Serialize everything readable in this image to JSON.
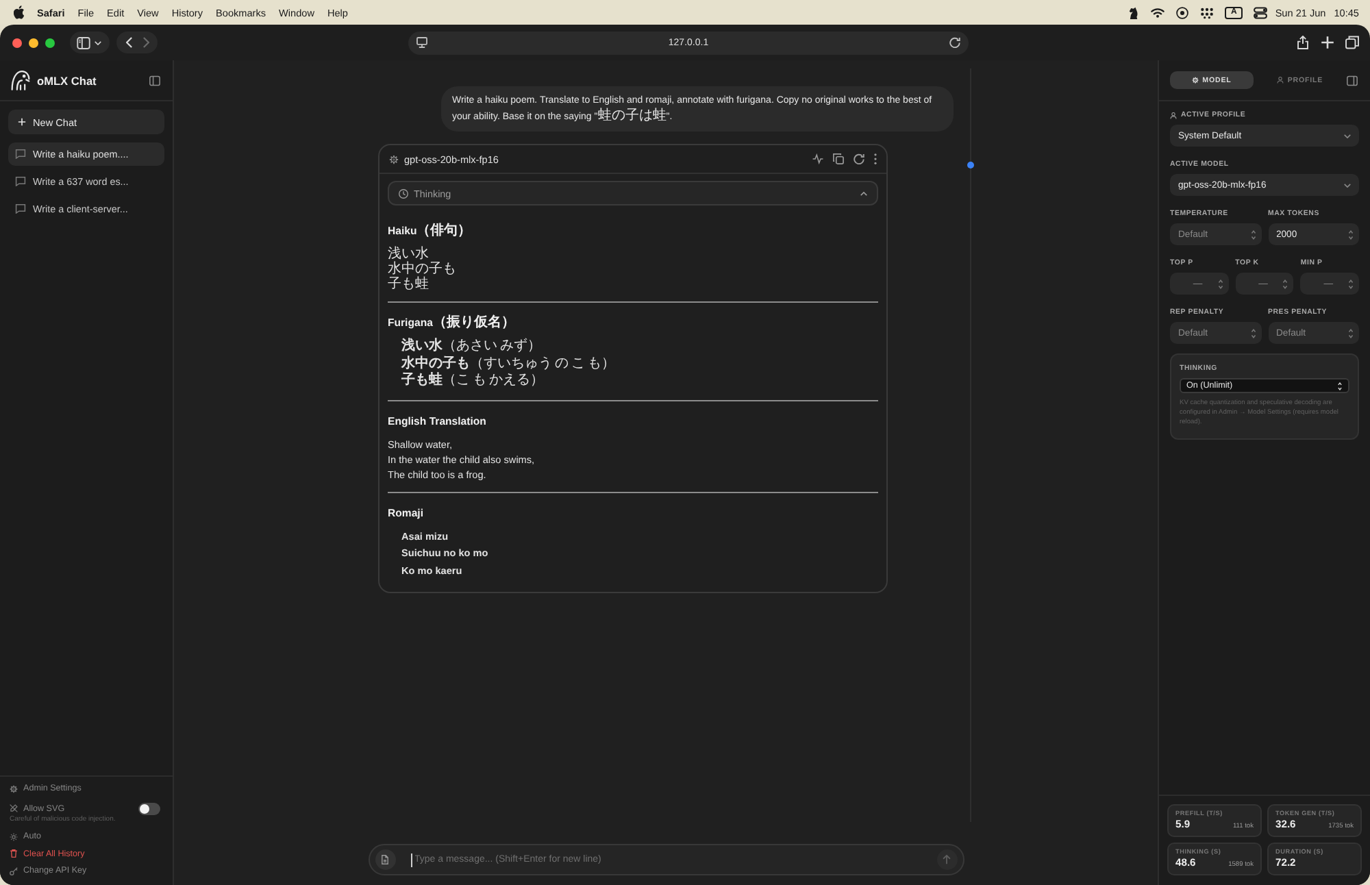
{
  "menu_bar": {
    "app": "Safari",
    "menus": [
      "File",
      "Edit",
      "View",
      "History",
      "Bookmarks",
      "Window",
      "Help"
    ],
    "input_source": "A",
    "date": "Sun 21 Jun",
    "time": "10:45"
  },
  "browser": {
    "address": "127.0.0.1"
  },
  "sidebar": {
    "title": "oMLX Chat",
    "new_chat": "New Chat",
    "chats": [
      {
        "title": "Write a haiku poem....",
        "selected": true
      },
      {
        "title": "Write a 637 word es...",
        "selected": false
      },
      {
        "title": "Write a client-server...",
        "selected": false
      }
    ],
    "admin_settings": "Admin Settings",
    "allow_svg": {
      "label": "Allow SVG",
      "on": false,
      "hint": "Careful of malicious code injection."
    },
    "theme": "Auto",
    "clear_history": "Clear All History",
    "change_api_key": "Change API Key"
  },
  "chat": {
    "user_message": "Write a haiku poem. Translate to English and romaji, annotate with furigana. Copy no original works to the best of your ability. Base it on the saying \"蛙の子は蛙\".",
    "response": {
      "model": "gpt-oss-20b-mlx-fp16",
      "thinking": "Thinking",
      "sections": [
        {
          "kind": "lines",
          "heading": "Haiku（俳句）",
          "lines": [
            "浅い水",
            "水中の子も",
            "子も蛙"
          ]
        },
        {
          "kind": "annotated_list",
          "heading": "Furigana（振り仮名）",
          "lines": [
            "**浅い水**（あさい みず）",
            "**水中の子も**（すいちゅう の こ も）",
            "**子も蛙**（こ も かえる）"
          ]
        },
        {
          "kind": "lines",
          "heading": "English Translation",
          "lines": [
            "Shallow water,",
            "In the water the child also swims,",
            "The child too is a frog."
          ]
        },
        {
          "kind": "bold_list",
          "heading": "Romaji",
          "lines": [
            "Asai mizu",
            "Suichuu no ko mo",
            "Ko mo kaeru"
          ]
        }
      ]
    },
    "input": {
      "placeholder": "Type a message... (Shift+Enter for new line)"
    }
  },
  "panel": {
    "tabs": [
      {
        "label": "MODEL",
        "selected": true
      },
      {
        "label": "PROFILE",
        "selected": false
      }
    ],
    "active_profile": {
      "label": "ACTIVE PROFILE",
      "value": "System Default"
    },
    "active_model": {
      "label": "ACTIVE MODEL",
      "value": "gpt-oss-20b-mlx-fp16"
    },
    "params": [
      {
        "fields": [
          {
            "label": "TEMPERATURE",
            "placeholder": "Default"
          },
          {
            "label": "MAX TOKENS",
            "value": "2000"
          }
        ]
      },
      {
        "fields": [
          {
            "label": "TOP P",
            "placeholder": "—"
          },
          {
            "label": "TOP K",
            "placeholder": "—"
          },
          {
            "label": "MIN P",
            "placeholder": "—"
          }
        ]
      },
      {
        "fields": [
          {
            "label": "REP PENALTY",
            "placeholder": "Default"
          },
          {
            "label": "PRES PENALTY",
            "placeholder": "Default"
          }
        ]
      }
    ],
    "thinking": {
      "label": "THINKING",
      "value": "On (Unlimit)",
      "note": "KV cache quantization and speculative decoding are configured in Admin → Model Settings (requires model reload)."
    },
    "stats": [
      {
        "label": "PREFILL (T/S)",
        "value": "5.9",
        "tokens": "111 tok"
      },
      {
        "label": "TOKEN GEN (T/S)",
        "value": "32.6",
        "tokens": "1735 tok"
      },
      {
        "label": "THINKING (S)",
        "value": "48.6",
        "tokens": "1589 tok"
      },
      {
        "label": "DURATION (S)",
        "value": "72.2"
      }
    ]
  }
}
